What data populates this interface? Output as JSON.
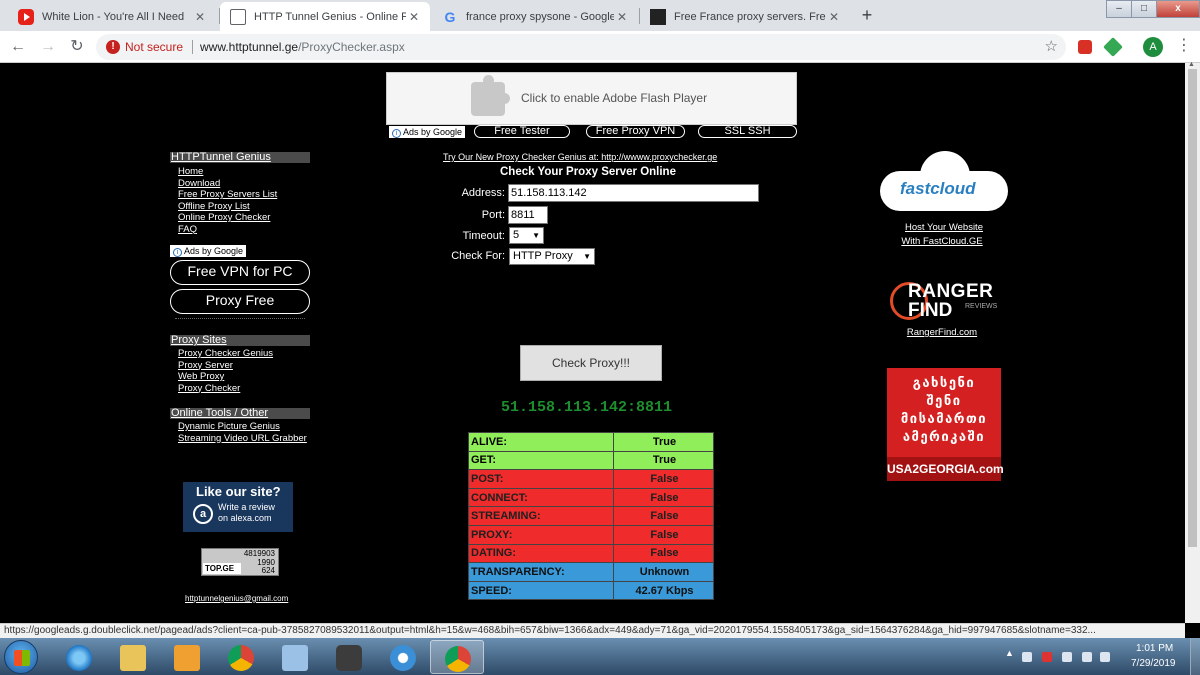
{
  "browser": {
    "tabs": [
      {
        "title": "White Lion - You're All I Need",
        "icon": "youtube-icon",
        "active": false
      },
      {
        "title": "HTTP Tunnel Genius - Online Proxy",
        "icon": "page-icon",
        "active": true
      },
      {
        "title": "france proxy spysone - Google Search",
        "icon": "google-icon",
        "active": false
      },
      {
        "title": "Free France proxy servers. French",
        "icon": "site-icon",
        "active": false
      }
    ],
    "new_tab_glyph": "+",
    "window_controls": {
      "minimize": "–",
      "maximize": "□",
      "close": "x"
    },
    "security_label": "Not secure",
    "url_host": "www.httptunnel.ge",
    "url_path": "/ProxyChecker.aspx",
    "profile_initial": "A"
  },
  "flash_placeholder": "Click to enable Adobe Flash Player",
  "top_ads": {
    "ads_by_google": "Ads by Google",
    "links": [
      "Free Tester",
      "Free Proxy VPN",
      "SSL SSH"
    ]
  },
  "sidebar": {
    "main_header": "HTTPTunnel Genius",
    "main_links": [
      "Home",
      "Download",
      "Free Proxy Servers List",
      "Offline Proxy List",
      "Online Proxy Checker",
      "FAQ"
    ],
    "ads_by_google": "Ads by Google",
    "ad_buttons": [
      "Free VPN for PC",
      "Proxy Free"
    ],
    "proxy_header": "Proxy Sites",
    "proxy_links": [
      "Proxy Checker Genius",
      "Proxy Server",
      "Web Proxy",
      "Proxy Checker"
    ],
    "tools_header": "Online Tools / Other",
    "tools_links": [
      "Dynamic Picture Genius",
      "Streaming Video URL Grabber"
    ],
    "alexa": {
      "title": "Like our site?",
      "line1": "Write a review",
      "line2": "on alexa.com",
      "glyph": "a"
    },
    "counter": {
      "logo": "TOP.GE",
      "values": [
        "4819903",
        "1990",
        "624"
      ]
    },
    "email": "httptunnelgenius@gmail.com"
  },
  "checker": {
    "promo_link": "Try Our New Proxy Checker Genius at: http://wwww.proxychecker.ge",
    "title": "Check Your Proxy Server Online",
    "address_label": "Address:",
    "address_value": "51.158.113.142",
    "port_label": "Port:",
    "port_value": "8811",
    "timeout_label": "Timeout:",
    "timeout_value": "5",
    "checkfor_label": "Check For:",
    "checkfor_value": "HTTP Proxy",
    "check_button": "Check Proxy!!!",
    "result_address": "51.158.113.142:8811",
    "results": [
      {
        "label": "ALIVE:",
        "value": "True",
        "status": "green"
      },
      {
        "label": "GET:",
        "value": "True",
        "status": "green"
      },
      {
        "label": "POST:",
        "value": "False",
        "status": "red"
      },
      {
        "label": "CONNECT:",
        "value": "False",
        "status": "red"
      },
      {
        "label": "STREAMING:",
        "value": "False",
        "status": "red"
      },
      {
        "label": "PROXY:",
        "value": "False",
        "status": "red"
      },
      {
        "label": "DATING:",
        "value": "False",
        "status": "red"
      },
      {
        "label": "TRANSPARENCY:",
        "value": "Unknown",
        "status": "blue"
      },
      {
        "label": "SPEED:",
        "value": "42.67 Kbps",
        "status": "blue"
      }
    ]
  },
  "right_ads": {
    "fastcloud_logo": "fastcloud",
    "fastcloud_link1": "Host Your Website",
    "fastcloud_link2": "With FastCloud.GE",
    "ranger_word1": "RANGER",
    "ranger_word2": "FIND",
    "ranger_word3": "REVIEWS",
    "ranger_link": "RangerFind.com",
    "usa_lines": [
      "გახსენი",
      "შენი",
      "მისამართი",
      "ამერიკაში"
    ],
    "usa_domain": "USA2GEORGIA.com"
  },
  "status_bar": "https://googleads.g.doubleclick.net/pagead/ads?client=ca-pub-3785827089532011&output=html&h=15&w=468&bih=657&biw=1366&adx=449&ady=71&ga_vid=2020179554.1558405173&ga_sid=1564376284&ga_hid=997947685&slotname=332...",
  "taskbar": {
    "apps": [
      "internet-explorer",
      "file-explorer",
      "media-player",
      "chrome",
      "notes",
      "nox",
      "browser",
      "chrome-active"
    ],
    "time": "1:01 PM",
    "date": "7/29/2019"
  },
  "colors": {
    "alive": "#90ee5a",
    "fail": "#ef2b2b",
    "info": "#3a9ad9",
    "result_green": "#1d8e2e"
  }
}
